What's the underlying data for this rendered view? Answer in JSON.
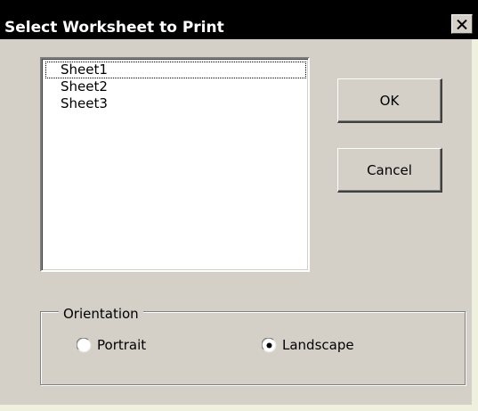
{
  "dialog": {
    "title": "Select Worksheet to Print",
    "close_icon": "close-x-icon"
  },
  "sheets": {
    "items": [
      {
        "label": "Sheet1",
        "focused": true
      },
      {
        "label": "Sheet2",
        "focused": false
      },
      {
        "label": "Sheet3",
        "focused": false
      }
    ]
  },
  "buttons": {
    "ok_label": "OK",
    "cancel_label": "Cancel"
  },
  "orientation": {
    "legend": "Orientation",
    "options": [
      {
        "label": "Portrait",
        "selected": false
      },
      {
        "label": "Landscape",
        "selected": true
      }
    ]
  },
  "colors": {
    "title_bar": "#000000",
    "face": "#d4d0c8",
    "window_bg": "#f0f0df"
  }
}
